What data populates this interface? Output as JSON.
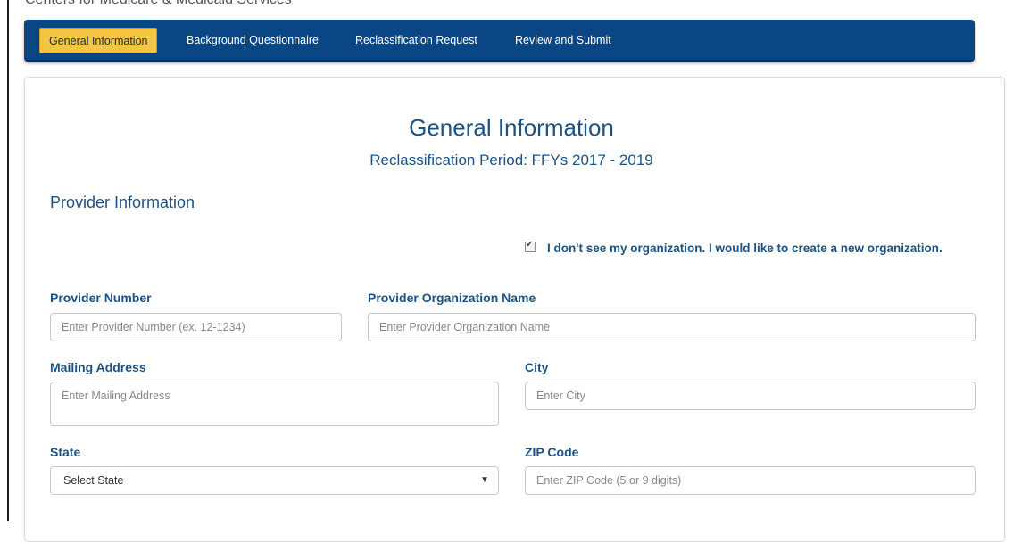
{
  "header": {
    "cut_off_title": "Centers for Medicare & Medicaid Services"
  },
  "nav": {
    "tabs": [
      {
        "label": "General Information",
        "active": true
      },
      {
        "label": "Background Questionnaire",
        "active": false
      },
      {
        "label": "Reclassification Request",
        "active": false
      },
      {
        "label": "Review and Submit",
        "active": false
      }
    ],
    "colors": {
      "bar": "#0b4684",
      "active_tab": "#f4c543"
    }
  },
  "page": {
    "title": "General Information",
    "subtitle": "Reclassification Period: FFYs 2017 - 2019",
    "section_title": "Provider Information"
  },
  "new_org_checkbox": {
    "checked": true,
    "label": "I don't see my organization. I would like to create a new organization."
  },
  "form": {
    "provider_number": {
      "label": "Provider Number",
      "placeholder": "Enter Provider Number (ex. 12-1234)",
      "value": ""
    },
    "org_name": {
      "label": "Provider Organization Name",
      "placeholder": "Enter Provider Organization Name",
      "value": ""
    },
    "mailing_address": {
      "label": "Mailing Address",
      "placeholder": "Enter Mailing Address",
      "value": ""
    },
    "city": {
      "label": "City",
      "placeholder": "Enter City",
      "value": ""
    },
    "state": {
      "label": "State",
      "selected": "Select State"
    },
    "zip": {
      "label": "ZIP Code",
      "placeholder": "Enter ZIP Code (5 or 9 digits)",
      "value": ""
    }
  }
}
